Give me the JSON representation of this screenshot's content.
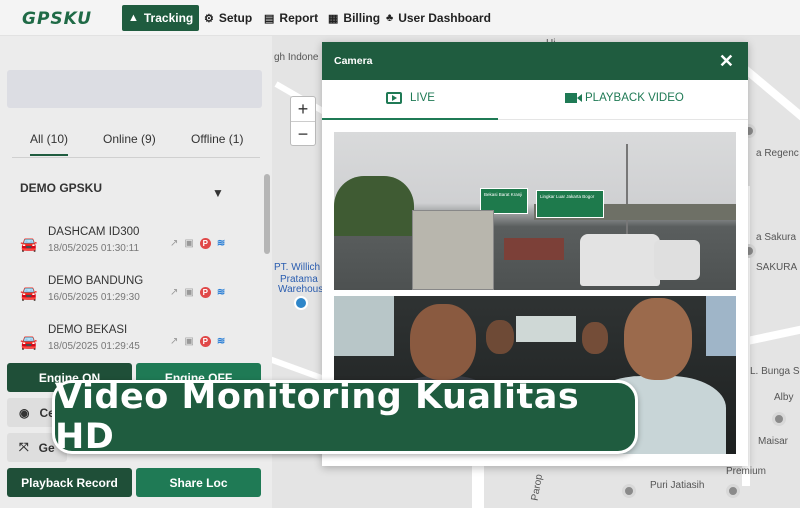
{
  "brand": {
    "logo": "GPSKU"
  },
  "nav": [
    {
      "label": "Tracking",
      "icon": "navigation-arrow-icon",
      "active": true
    },
    {
      "label": "Setup",
      "icon": "gear-icon"
    },
    {
      "label": "Report",
      "icon": "document-icon"
    },
    {
      "label": "Billing",
      "icon": "billing-icon"
    },
    {
      "label": "User Dashboard",
      "icon": "users-icon"
    }
  ],
  "sidebar": {
    "tabs": [
      {
        "label": "All (10)",
        "selected": true
      },
      {
        "label": "Online (9)"
      },
      {
        "label": "Offline (1)"
      }
    ],
    "group_title": "DEMO GPSKU",
    "devices": [
      {
        "name": "DASHCAM ID300",
        "time": "18/05/2025 01:30:11"
      },
      {
        "name": "DEMO BANDUNG",
        "time": "16/05/2025 01:29:30"
      },
      {
        "name": "DEMO BEKASI",
        "time": "18/05/2025 01:29:45"
      }
    ],
    "device_status_icons": [
      "trend-icon",
      "bus-icon",
      "parking-icon",
      "wifi-icon"
    ],
    "buttons": {
      "engine_on": "Engine ON",
      "engine_off": "Engine OFF",
      "center": "Ce",
      "geofence": "Ge",
      "playback_record": "Playback Record",
      "share_loc": "Share Loc"
    }
  },
  "map": {
    "zoom_in": "+",
    "zoom_out": "−",
    "labels": {
      "top_left": "gh Indone",
      "top_mid": "Hi",
      "willich": "PT. Willich",
      "pratama": "Pratama",
      "warehouse": "Warehouse",
      "regenc": "a Regenc",
      "sakura": "a Sakura",
      "sakura2": "SAKURA",
      "bunga": "L. Bunga Se",
      "alby": "Alby",
      "maisar": "Maisar",
      "premium": "Premium",
      "jatiasih": "Puri Jatiasih",
      "paro": "Parop"
    }
  },
  "modal": {
    "title": "Camera",
    "close": "✕",
    "tab_live": "LIVE",
    "tab_playback": "PLAYBACK VIDEO",
    "sign1": "Bekasi Barat Kranji",
    "sign2": "Lingkar Luar Jakarta Bogor"
  },
  "banner": {
    "text": "Video Monitoring Kualitas HD"
  },
  "colors": {
    "brand_green": "#1f5c3f",
    "accent_green": "#1f7a55",
    "status_red": "#e04848",
    "wifi_blue": "#2a7fd6"
  }
}
